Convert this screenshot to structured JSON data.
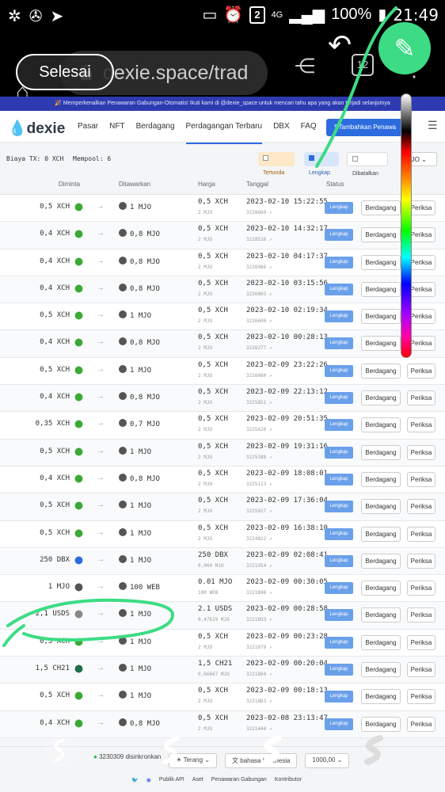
{
  "statusbar": {
    "battery": "100%",
    "time": "21:49",
    "network": "4G",
    "notif_count": "2"
  },
  "browser": {
    "done_label": "Selesai",
    "url": "dexie.space/trad",
    "tabs_count": "12"
  },
  "banner": "🎉 Memperkenalkan Penawaran Gabungan-Otomatis! Ikuti kami di @dexie_space untuk mencari tahu apa yang akan terjadi selanjutnya",
  "nav": {
    "logo": "dexie",
    "links": [
      "Pasar",
      "NFT",
      "Berdagang",
      "Perdagangan Terbaru",
      "DBX",
      "FAQ"
    ],
    "active_link": "Perdagangan Terbaru",
    "add_offer": "Tambahkan Penawa"
  },
  "filters": {
    "fee_label": "Biaya TX:",
    "fee_value": "0 XCH",
    "mempool_label": "Mempool:",
    "mempool_value": "6",
    "pending": "Tertunda",
    "done": "Lengkap",
    "cancelled": "Dibatalkan",
    "token_select": "MJO"
  },
  "table": {
    "headers": {
      "requested": "Diminta",
      "offered": "Ditawarkan",
      "price": "Harga",
      "date": "Tanggal",
      "status": "Status"
    },
    "rows": [
      {
        "want": "0,5 XCH",
        "offer": "1 MJO",
        "price": "0,5 XCH",
        "price_sub": "2 MJO",
        "date": "2023-02-10 15:22:55",
        "id": "3228669"
      },
      {
        "want": "0,4 XCH",
        "offer": "0,8 MJO",
        "price": "0,5 XCH",
        "price_sub": "2 MJO",
        "date": "2023-02-10 14:32:17",
        "id": "3228516"
      },
      {
        "want": "0,4 XCH",
        "offer": "0,8 MJO",
        "price": "0,5 XCH",
        "price_sub": "2 MJO",
        "date": "2023-02-10 04:17:37",
        "id": "3226966"
      },
      {
        "want": "0,4 XCH",
        "offer": "0,8 MJO",
        "price": "0,5 XCH",
        "price_sub": "2 MJO",
        "date": "2023-02-10 03:15:56",
        "id": "3226803"
      },
      {
        "want": "0,5 XCH",
        "offer": "1 MJO",
        "price": "0,5 XCH",
        "price_sub": "2 MJO",
        "date": "2023-02-10 02:19:34",
        "id": "3226600"
      },
      {
        "want": "0,4 XCH",
        "offer": "0,8 MJO",
        "price": "0,5 XCH",
        "price_sub": "2 MJO",
        "date": "2023-02-10 00:28:13",
        "id": "3226277"
      },
      {
        "want": "0,5 XCH",
        "offer": "1 MJO",
        "price": "0,5 XCH",
        "price_sub": "2 MJO",
        "date": "2023-02-09 23:22:26",
        "id": "3226080"
      },
      {
        "want": "0,4 XCH",
        "offer": "0,8 MJO",
        "price": "0,5 XCH",
        "price_sub": "2 MJO",
        "date": "2023-02-09 22:13:12",
        "id": "3225851"
      },
      {
        "want": "0,35 XCH",
        "offer": "0,7 MJO",
        "price": "0,5 XCH",
        "price_sub": "2 MJO",
        "date": "2023-02-09 20:51:35",
        "id": "3225620"
      },
      {
        "want": "0,5 XCH",
        "offer": "1 MJO",
        "price": "0,5 XCH",
        "price_sub": "2 MJO",
        "date": "2023-02-09 19:31:16",
        "id": "3225388"
      },
      {
        "want": "0,4 XCH",
        "offer": "0,8 MJO",
        "price": "0,5 XCH",
        "price_sub": "2 MJO",
        "date": "2023-02-09 18:08:01",
        "id": "3225123"
      },
      {
        "want": "0,5 XCH",
        "offer": "1 MJO",
        "price": "0,5 XCH",
        "price_sub": "2 MJO",
        "date": "2023-02-09 17:36:04",
        "id": "3225027"
      },
      {
        "want": "0,5 XCH",
        "offer": "1 MJO",
        "price": "0,5 XCH",
        "price_sub": "2 MJO",
        "date": "2023-02-09 16:38:10",
        "id": "3224822"
      },
      {
        "want": "250 DBX",
        "offer": "1 MJO",
        "price": "250 DBX",
        "price_sub": "0,004 MJO",
        "date": "2023-02-09 02:08:41",
        "id": "3221954"
      },
      {
        "want": "1 MJO",
        "offer": "100 WEB",
        "price": "0.01 MJO",
        "price_sub": "100 WEB",
        "date": "2023-02-09 00:30:05",
        "id": "3221896"
      },
      {
        "want": "2,1 USDS",
        "offer": "1 MJO",
        "price": "2.1 USDS",
        "price_sub": "0,47619 MJO",
        "date": "2023-02-09 00:28:58",
        "id": "3221893"
      },
      {
        "want": "0,5 XCH",
        "offer": "1 MJO",
        "price": "0,5 XCH",
        "price_sub": "2 MJO",
        "date": "2023-02-09 00:23:28",
        "id": "3221879"
      },
      {
        "want": "1,5 CH21",
        "offer": "1 MJO",
        "price": "1,5 CH21",
        "price_sub": "0,66667 MJO",
        "date": "2023-02-09 00:20:04",
        "id": "3221869"
      },
      {
        "want": "0,5 XCH",
        "offer": "1 MJO",
        "price": "0,5 XCH",
        "price_sub": "2 MJO",
        "date": "2023-02-09 00:18:13",
        "id": "3221863"
      },
      {
        "want": "0,4 XCH",
        "offer": "0,8 MJO",
        "price": "0,5 XCH",
        "price_sub": "2 MJO",
        "date": "2023-02-08 23:13:47",
        "id": "3221444"
      }
    ],
    "status_label": "Lengkap",
    "trade_label": "Berdagang",
    "check_label": "Periksa"
  },
  "footer": {
    "synced": "3230309 disinkronkan",
    "theme": "Terang",
    "language": "bahasa Indonesia",
    "zoom": "1000,00",
    "links": [
      "Publik API",
      "Aset",
      "Penawaran Gabungan",
      "Kontributor"
    ]
  },
  "colors": {
    "accent": "#2d6cdf",
    "annotation": "#3ddc84",
    "banner": "#2e3bb0"
  }
}
